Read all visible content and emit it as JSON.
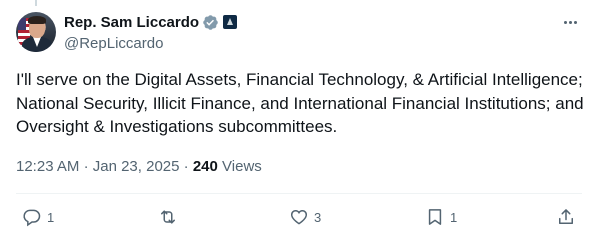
{
  "author": {
    "display_name": "Rep. Sam Liccardo",
    "handle": "@RepLiccardo",
    "verified_icon": "verified-badge-icon",
    "affiliation_icon": "government-badge-icon"
  },
  "tweet": {
    "text": "I'll serve on the Digital Assets, Financial Technology, & Artificial Intelligence; National Security, Illicit Finance, and International Financial Institutions; and Oversight & Investigations subcommittees.",
    "time": "12:23 AM",
    "separator": "·",
    "date": "Jan 23, 2025",
    "views_count": "240",
    "views_label": "Views"
  },
  "actions": {
    "reply_count": "1",
    "retweet_count": "",
    "like_count": "3",
    "bookmark_count": "1"
  },
  "colors": {
    "text_primary": "#0f1419",
    "text_secondary": "#536471",
    "verified_fill": "#829aab",
    "divider": "#eff3f4"
  }
}
